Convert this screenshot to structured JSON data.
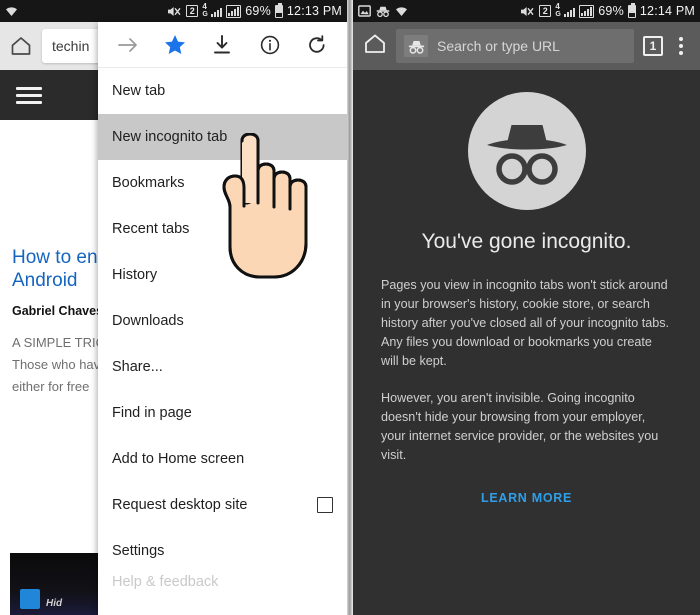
{
  "left_phone": {
    "status_bar": {
      "icons": [
        "wifi-icon",
        "mute-icon",
        "sim-icon",
        "4g-icon",
        "signal-bars-icon",
        "signal-boxed-icon"
      ],
      "sim_label": "2",
      "network_label": "4G",
      "battery_percent": "69%",
      "time": "12:13 PM"
    },
    "browser": {
      "home_icon": "home-icon",
      "url_value": "techin",
      "menu_icon": "hamburger-icon"
    },
    "webpage": {
      "logo": "spotify-logo",
      "title": "How to en\nAndroid",
      "title_line1": "How to en",
      "title_line2": "Android",
      "author": "Gabriel Chaves",
      "body_line1": "A SIMPLE TRIC",
      "body_line2": "Those who hav",
      "body_line3": "either for free",
      "banner_text": "Hid"
    },
    "overflow_menu": {
      "toolbar_icons": [
        {
          "name": "forward-arrow-icon",
          "color": "#9a9a9a"
        },
        {
          "name": "bookmark-star-icon",
          "color": "#1a73e8"
        },
        {
          "name": "download-icon",
          "color": "#2b2b2b"
        },
        {
          "name": "page-info-icon",
          "color": "#2b2b2b"
        },
        {
          "name": "reload-icon",
          "color": "#2b2b2b"
        }
      ],
      "items": [
        {
          "label": "New tab",
          "highlighted": false,
          "checkbox": false
        },
        {
          "label": "New incognito tab",
          "highlighted": true,
          "checkbox": false
        },
        {
          "label": "Bookmarks",
          "highlighted": false,
          "checkbox": false
        },
        {
          "label": "Recent tabs",
          "highlighted": false,
          "checkbox": false
        },
        {
          "label": "History",
          "highlighted": false,
          "checkbox": false
        },
        {
          "label": "Downloads",
          "highlighted": false,
          "checkbox": false
        },
        {
          "label": "Share...",
          "highlighted": false,
          "checkbox": false
        },
        {
          "label": "Find in page",
          "highlighted": false,
          "checkbox": false
        },
        {
          "label": "Add to Home screen",
          "highlighted": false,
          "checkbox": false
        },
        {
          "label": "Request desktop site",
          "highlighted": false,
          "checkbox": true
        },
        {
          "label": "Settings",
          "highlighted": false,
          "checkbox": false
        },
        {
          "label": "Help & feedback",
          "highlighted": false,
          "checkbox": false
        }
      ],
      "cursor": "pointing-hand-icon"
    }
  },
  "right_phone": {
    "status_bar": {
      "icons": [
        "screenshot-icon",
        "incognito-icon",
        "wifi-icon",
        "mute-icon",
        "sim-icon",
        "4g-icon",
        "signal-bars-icon",
        "signal-boxed-icon"
      ],
      "sim_label": "2",
      "network_label": "4G",
      "battery_percent": "69%",
      "time": "12:14 PM"
    },
    "browser": {
      "home_icon": "home-icon",
      "incognito_icon": "incognito-icon",
      "url_placeholder": "Search or type URL",
      "tab_count": "1",
      "overflow_icon": "kebab-menu-icon"
    },
    "page": {
      "avatar_icon": "incognito-avatar-icon",
      "title": "You've gone incognito.",
      "paragraph_1": "Pages you view in incognito tabs won't stick around in your browser's history, cookie store, or search history after you've closed all of your incognito tabs. Any files you download or bookmarks you create will be kept.",
      "paragraph_2": "However, you aren't invisible. Going incognito doesn't hide your browsing from your employer, your internet service provider, or the websites you visit.",
      "learn_more_label": "LEARN MORE"
    }
  },
  "colors": {
    "accent_blue": "#1a73e8",
    "link_blue": "#2f9ee8",
    "incognito_bg": "#303030",
    "incognito_toolbar": "#5b5b5b",
    "status_bar_bg": "#161616",
    "menu_highlight": "#c8c8c8",
    "spotify_green": "#1DB954"
  }
}
